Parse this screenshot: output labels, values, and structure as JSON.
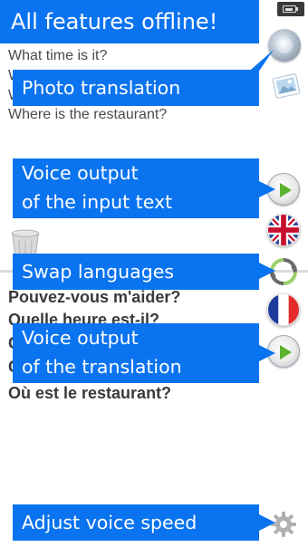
{
  "callouts": {
    "offline": "All features offline!",
    "photo": "Photo translation",
    "voice_input": "Voice output\nof the input text",
    "swap": "Swap languages",
    "voice_translation": "Voice output\nof the translation",
    "speed": "Adjust voice speed"
  },
  "source_text": {
    "line2": "What time is it?",
    "line3_visible": "W",
    "line4_visible": "W",
    "line5": "Where is the restaurant?"
  },
  "target_text": {
    "line1": "Pouvez-vous m'aider?",
    "line2": "Quelle heure est-il?",
    "line3_visible": "C",
    "line4_visible": "C",
    "line5": "Où est le restaurant?"
  },
  "icons": {
    "battery": "battery-charging-icon",
    "camera": "camera-icon",
    "photo": "photo-icon",
    "play_input": "play-icon",
    "source_flag": "uk-flag-icon",
    "swap": "swap-icon",
    "target_flag": "french-flag-icon",
    "play_translation": "play-icon",
    "clear": "trash-icon",
    "settings": "gear-icon"
  },
  "colors": {
    "callout": "#0a73f0",
    "play": "#5cb32d"
  },
  "status": {
    "battery_level": 0.7
  }
}
